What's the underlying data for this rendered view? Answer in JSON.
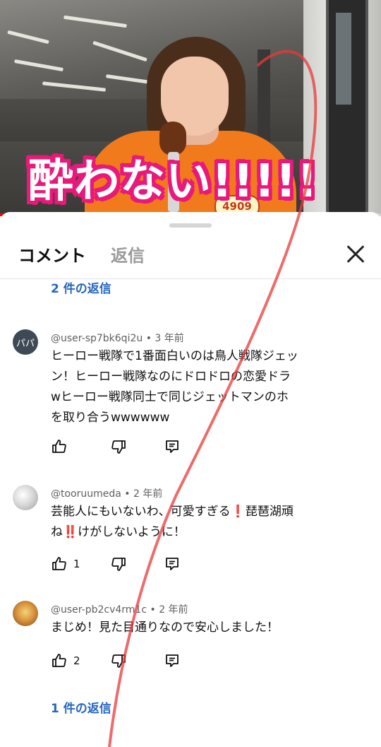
{
  "video": {
    "overlay_text": "酔わない!!!!!",
    "badge_number": "4909",
    "progress_fraction": 0.35
  },
  "sheet": {
    "tabs": {
      "comments": "コメント",
      "replies": "返信"
    },
    "close_icon": "close-icon",
    "top_reply_link": "2 件の返信",
    "comments": [
      {
        "avatar_text": "パパ",
        "author": "@user-sp7bk6qi2u",
        "age": "3 年前",
        "lines": [
          "ヒーロー戦隊で1番面白いのは鳥人戦隊ジェッ",
          "ン！ヒーロー戦隊なのにドロドロの恋愛ドラ",
          "wヒーロー戦隊同士で同じジェットマンのホ",
          "を取り合うwwwwww"
        ],
        "likes": ""
      },
      {
        "avatar_text": "",
        "author": "@tooruumeda",
        "age": "2 年前",
        "lines": [
          "芸能人にもいないわ、可愛すぎる❗琵琶湖頑",
          "ね‼️けがしないように！"
        ],
        "likes": "1"
      },
      {
        "avatar_text": "",
        "author": "@user-pb2cv4rm1c",
        "age": "2 年前",
        "lines": [
          "まじめ！見た目通りなので安心しました！"
        ],
        "likes": "2"
      }
    ],
    "bottom_reply_link": "1 件の返信"
  },
  "colors": {
    "link_blue": "#2566c2",
    "overlay_pink": "#e8197a",
    "shirt_orange": "#f07a1c",
    "progress_red": "#ff0000"
  }
}
